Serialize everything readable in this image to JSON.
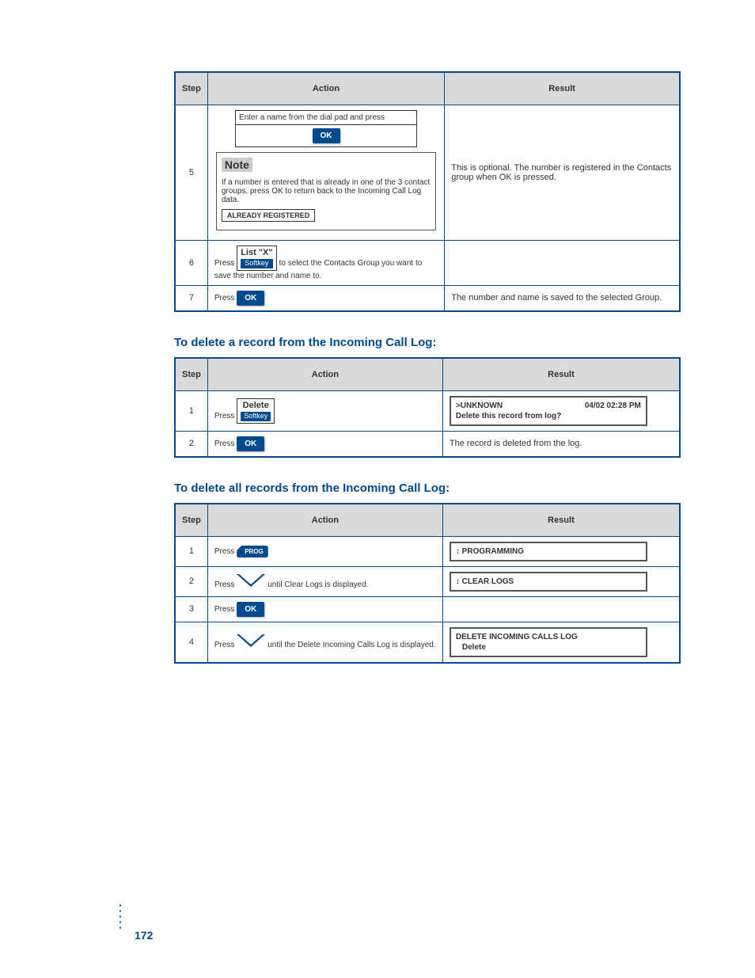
{
  "table1": {
    "headers": [
      "Step",
      "Action",
      "Result"
    ],
    "rows": {
      "step5": {
        "num": "5",
        "label_text": "Enter a name from the dial pad and press",
        "ok": "OK",
        "note_label": "Note",
        "note_body": "If a number is entered that is already in one of the 3 contact groups, press OK to return back to the Incoming Call Log data.",
        "lcd": "ALREADY REGISTERED",
        "result": "This is optional. The number is registered in the Contacts group when OK is pressed."
      },
      "step6": {
        "num": "6",
        "soft_label": "List \"X\"",
        "soft_btn": "Softkey",
        "action_suffix": " to select the Contacts Group you want to save the number and name to.",
        "result": ""
      },
      "step7": {
        "num": "7",
        "ok": "OK",
        "result": "The number and name is saved to the selected Group."
      }
    }
  },
  "heading_delete_one": "To delete a record from the Incoming Call Log:",
  "table2": {
    "headers": [
      "Step",
      "Action",
      "Result"
    ],
    "rows": {
      "step1": {
        "num": "1",
        "soft_label": "Delete",
        "soft_btn": "Softkey",
        "lcd_line1_left": ">UNKNOWN",
        "lcd_line1_right": "04/02 02:28 PM",
        "lcd_line2": "Delete this record from log?"
      },
      "step2": {
        "num": "2",
        "ok": "OK",
        "result": "The record is deleted from the log."
      }
    }
  },
  "heading_delete_all": "To delete all records from the Incoming Call Log:",
  "table3": {
    "headers": [
      "Step",
      "Action",
      "Result"
    ],
    "rows": {
      "step1": {
        "num": "1",
        "prog": "PROG",
        "lcd_icon": "↕",
        "lcd": "PROGRAMMING"
      },
      "step2": {
        "num": "2",
        "action_text": "until Clear Logs is displayed.",
        "lcd_icon": "↕",
        "lcd": "CLEAR LOGS"
      },
      "step3": {
        "num": "3",
        "ok": "OK",
        "result": ""
      },
      "step4": {
        "num": "4",
        "action_text": "until the Delete Incoming Calls Log is displayed.",
        "lcd_line1": "DELETE INCOMING CALLS LOG",
        "lcd_line2": "Delete"
      }
    }
  },
  "page_number": "172"
}
